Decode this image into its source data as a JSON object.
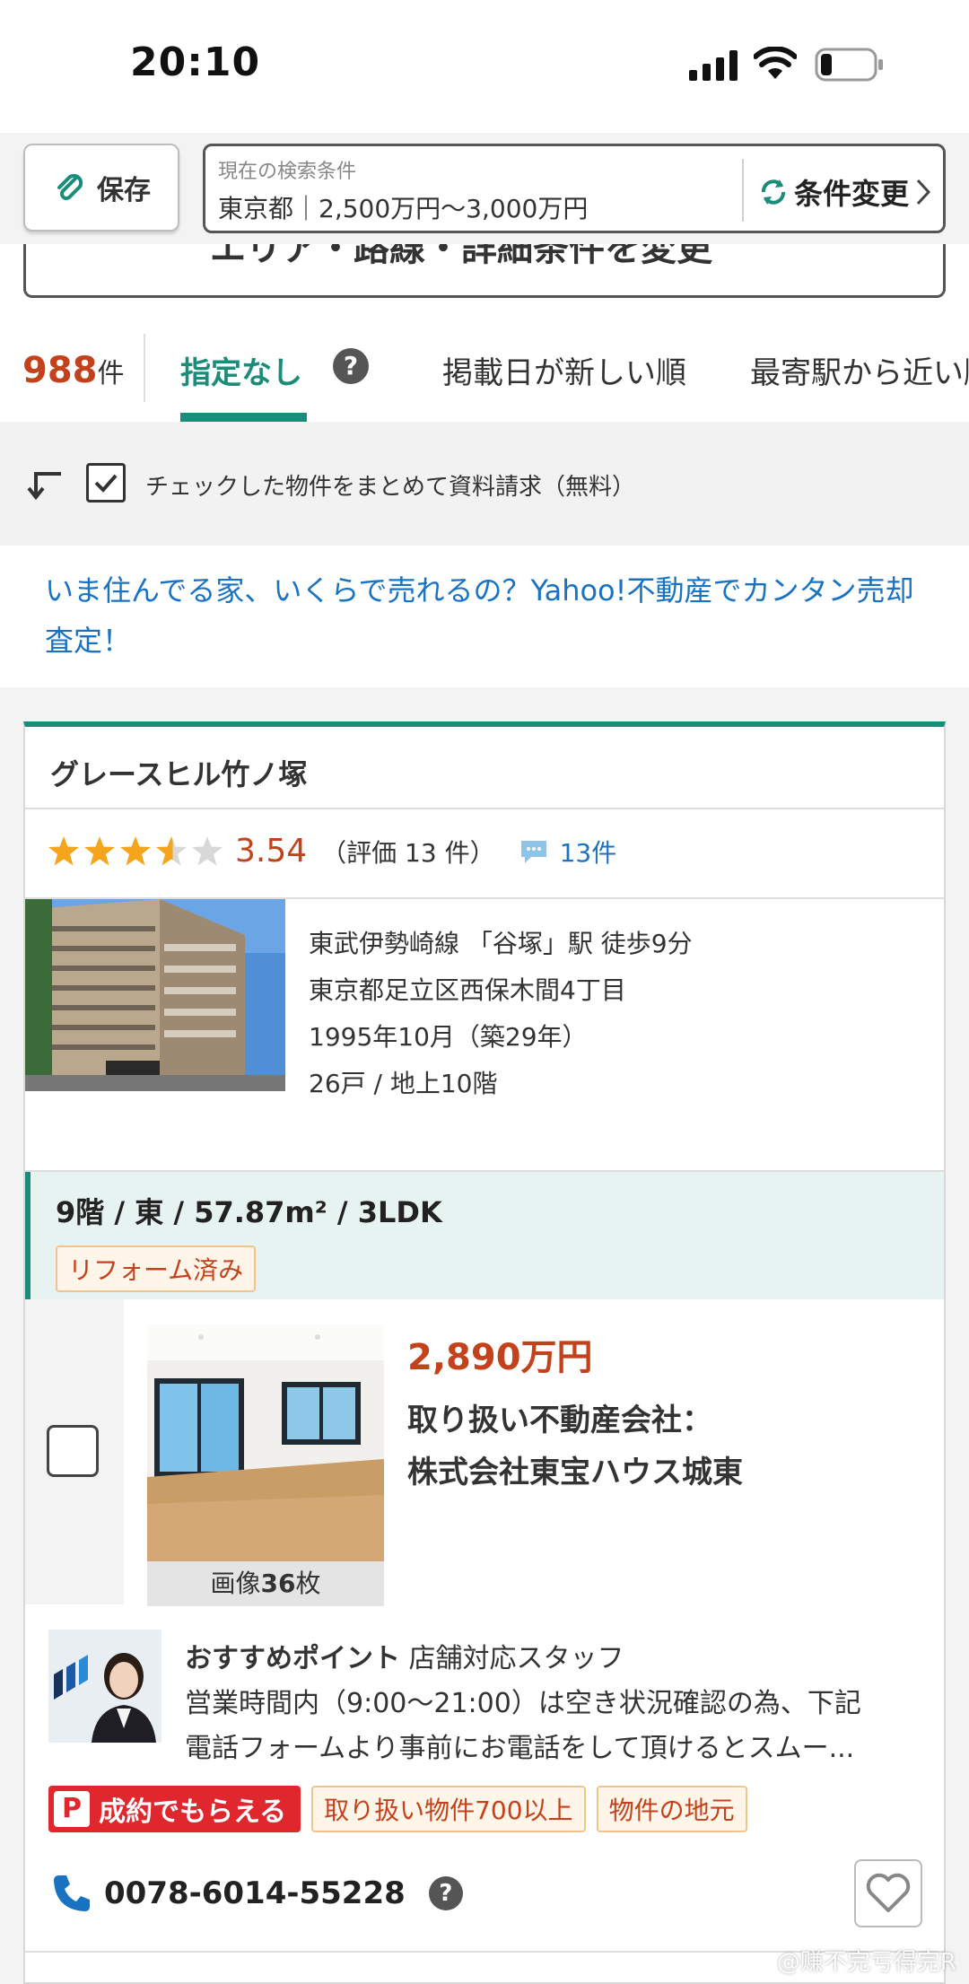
{
  "status_bar": {
    "time": "20:10"
  },
  "header": {
    "save_label": "保存",
    "conditions_caption": "現在の検索条件",
    "conditions_value": "東京都｜2,500万円〜3,000万円",
    "change_label": "条件変更",
    "area_button_label": "エリア・路線・詳細条件を変更"
  },
  "sort": {
    "count_number": "988",
    "count_unit": "件",
    "tabs": [
      {
        "label": "指定なし",
        "active": true
      },
      {
        "label": "掲載日が新しい順"
      },
      {
        "label": "最寄駅から近い順"
      }
    ],
    "help": "?"
  },
  "bulk_request": {
    "label": "チェックした物件をまとめて資料請求（無料）"
  },
  "promo": {
    "text": "いま住んでる家、いくらで売れるの？Yahoo!不動産でカンタン売却査定！"
  },
  "property": {
    "name": "グレースヒル竹ノ塚",
    "rating": {
      "stars": 3.54,
      "score": "3.54",
      "count_text": "（評価 13 件）",
      "reviews_text": "13件"
    },
    "building_info": [
      "東武伊勢崎線 「谷塚」駅 徒歩9分",
      "東京都足立区西保木間4丁目",
      "1995年10月（築29年）",
      "26戸 / 地上10階"
    ],
    "unit": {
      "spec": "9階 / 東 / 57.87m² / 3LDK",
      "tag": "リフォーム済み",
      "image_caption_prefix": "画像",
      "image_count": "36",
      "image_caption_suffix": "枚",
      "price": "2,890万円",
      "agency_label": "取り扱い不動産会社：",
      "agency_name": "株式会社東宝ハウス城東"
    },
    "recommend": {
      "title": "おすすめポイント",
      "staff": "店舗対応スタッフ",
      "line1": "営業時間内（9:00〜21:00）は空き状況確認の為、下記",
      "line2": "電話フォームより事前にお電話をして頂けるとスムー..."
    },
    "badges": {
      "paypay": "成約でもらえる",
      "tag1": "取り扱い物件700以上",
      "tag2": "物件の地元"
    },
    "phone": "0078-6014-55228"
  },
  "watermark": "@赚不完亏得完R",
  "colors": {
    "accent": "#1a8c7a",
    "price": "#c3421b",
    "link": "#1a72c2",
    "paypay": "#e0272e"
  }
}
